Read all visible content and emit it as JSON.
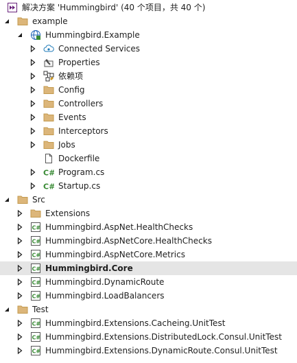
{
  "solution_explorer": {
    "rows": [
      {
        "level": 0,
        "arrow": "none",
        "icon": "solution-icon",
        "label": "解决方案 'Hummingbird' (40 个项目，共 40 个)"
      },
      {
        "level": 0,
        "arrow": "expanded",
        "icon": "folder-icon",
        "label": "example"
      },
      {
        "level": 1,
        "arrow": "expanded",
        "icon": "web-project-icon",
        "label": "Hummingbird.Example"
      },
      {
        "level": 2,
        "arrow": "collapsed",
        "icon": "connected-services-icon",
        "label": "Connected Services"
      },
      {
        "level": 2,
        "arrow": "collapsed",
        "icon": "wrench-icon",
        "label": "Properties"
      },
      {
        "level": 2,
        "arrow": "collapsed",
        "icon": "dependencies-icon",
        "label": "依赖项"
      },
      {
        "level": 2,
        "arrow": "collapsed",
        "icon": "folder-icon",
        "label": "Config"
      },
      {
        "level": 2,
        "arrow": "collapsed",
        "icon": "folder-icon",
        "label": "Controllers"
      },
      {
        "level": 2,
        "arrow": "collapsed",
        "icon": "folder-icon",
        "label": "Events"
      },
      {
        "level": 2,
        "arrow": "collapsed",
        "icon": "folder-icon",
        "label": "Interceptors"
      },
      {
        "level": 2,
        "arrow": "collapsed",
        "icon": "folder-icon",
        "label": "Jobs"
      },
      {
        "level": 2,
        "arrow": "none",
        "icon": "file-icon",
        "label": "Dockerfile"
      },
      {
        "level": 2,
        "arrow": "collapsed",
        "icon": "csharp-file-icon",
        "label": "Program.cs"
      },
      {
        "level": 2,
        "arrow": "collapsed",
        "icon": "csharp-file-icon",
        "label": "Startup.cs"
      },
      {
        "level": 0,
        "arrow": "expanded",
        "icon": "folder-icon",
        "label": "Src"
      },
      {
        "level": 1,
        "arrow": "collapsed",
        "icon": "folder-icon",
        "label": "Extensions"
      },
      {
        "level": 1,
        "arrow": "collapsed",
        "icon": "csharp-project-icon",
        "label": "Hummingbird.AspNet.HealthChecks"
      },
      {
        "level": 1,
        "arrow": "collapsed",
        "icon": "csharp-project-icon",
        "label": "Hummingbird.AspNetCore.HealthChecks"
      },
      {
        "level": 1,
        "arrow": "collapsed",
        "icon": "csharp-project-icon",
        "label": "Hummingbird.AspNetCore.Metrics"
      },
      {
        "level": 1,
        "arrow": "collapsed",
        "icon": "csharp-project-icon",
        "label": "Hummingbird.Core",
        "selected": true
      },
      {
        "level": 1,
        "arrow": "collapsed",
        "icon": "csharp-project-icon",
        "label": "Hummingbird.DynamicRoute"
      },
      {
        "level": 1,
        "arrow": "collapsed",
        "icon": "csharp-project-icon",
        "label": "Hummingbird.LoadBalancers"
      },
      {
        "level": 0,
        "arrow": "expanded",
        "icon": "folder-icon",
        "label": "Test"
      },
      {
        "level": 1,
        "arrow": "collapsed",
        "icon": "csharp-project-icon",
        "label": "Hummingbird.Extensions.Cacheing.UnitTest"
      },
      {
        "level": 1,
        "arrow": "collapsed",
        "icon": "csharp-project-icon",
        "label": "Hummingbird.Extensions.DistributedLock.Consul.UnitTest"
      },
      {
        "level": 1,
        "arrow": "collapsed",
        "icon": "csharp-project-icon",
        "label": "Hummingbird.Extensions.DynamicRoute.Consul.UnitTest"
      }
    ]
  },
  "colors": {
    "folder": "#dcb67a",
    "folder_edge": "#c39a4f",
    "csharp": "#388a34",
    "solution": "#68217a",
    "web": "#1a5fb4",
    "selection": "#e5e5e5",
    "arrow": "#1e1e1e"
  }
}
